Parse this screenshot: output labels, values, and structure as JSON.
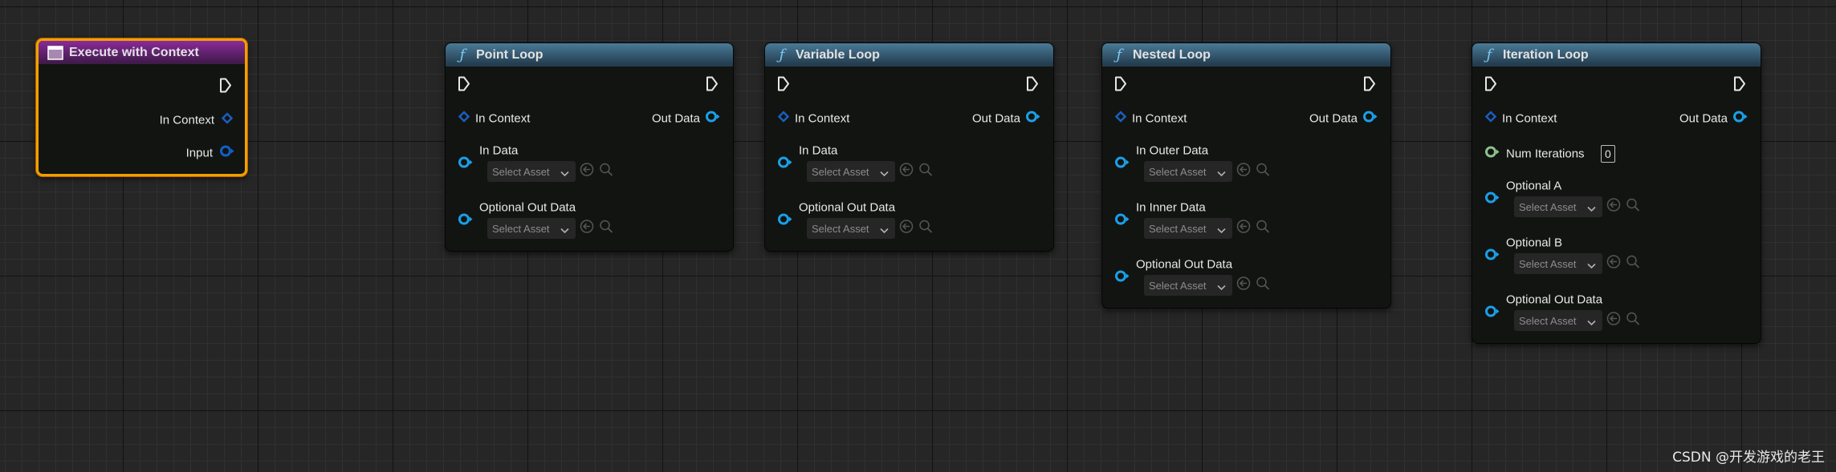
{
  "nodes": [
    {
      "title": "Execute with Context",
      "kind": "event",
      "icon": "event-icon",
      "selected": true,
      "outputs": [
        {
          "label": "In Context",
          "pin": "context"
        },
        {
          "label": "Input",
          "pin": "data"
        }
      ]
    },
    {
      "title": "Point Loop",
      "kind": "function",
      "icon": "function-icon",
      "in_context": "In Context",
      "out_data": "Out Data",
      "params": [
        {
          "label": "In Data",
          "select": "Select Asset"
        },
        {
          "label": "Optional Out Data",
          "select": "Select Asset"
        }
      ]
    },
    {
      "title": "Variable Loop",
      "kind": "function",
      "icon": "function-icon",
      "in_context": "In Context",
      "out_data": "Out Data",
      "params": [
        {
          "label": "In Data",
          "select": "Select Asset"
        },
        {
          "label": "Optional Out Data",
          "select": "Select Asset"
        }
      ]
    },
    {
      "title": "Nested Loop",
      "kind": "function",
      "icon": "function-icon",
      "in_context": "In Context",
      "out_data": "Out Data",
      "params": [
        {
          "label": "In Outer Data",
          "select": "Select Asset"
        },
        {
          "label": "In Inner Data",
          "select": "Select Asset"
        },
        {
          "label": "Optional Out Data",
          "select": "Select Asset"
        }
      ]
    },
    {
      "title": "Iteration Loop",
      "kind": "function",
      "icon": "function-icon",
      "in_context": "In Context",
      "out_data": "Out Data",
      "params": [
        {
          "label": "Num Iterations",
          "value": "0",
          "pin": "integer"
        },
        {
          "label": "Optional A",
          "select": "Select Asset"
        },
        {
          "label": "Optional B",
          "select": "Select Asset"
        },
        {
          "label": "Optional Out Data",
          "select": "Select Asset"
        }
      ]
    }
  ],
  "colors": {
    "selected_border": "#f0a000",
    "function_header": "#3f6e8c",
    "event_header": "#7a2a8a",
    "data_pin": "#1aa0e8",
    "context_pin": "#1a5fc0",
    "integer_pin": "#8fc08f",
    "exec_pin": "#e8e8e8"
  },
  "watermark": "CSDN @开发游戏的老王"
}
